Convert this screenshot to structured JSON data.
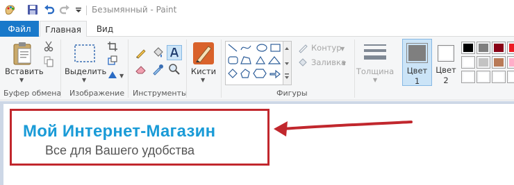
{
  "window": {
    "title": "Безымянный - Paint"
  },
  "tabs": {
    "file": "Файл",
    "home": "Главная",
    "view": "Вид"
  },
  "ribbon": {
    "clipboard": {
      "paste": "Вставить",
      "group": "Буфер обмена"
    },
    "image": {
      "select": "Выделить",
      "group": "Изображение"
    },
    "tools": {
      "group": "Инструменты"
    },
    "brushes": {
      "label": "Кисти"
    },
    "shapes": {
      "outline": "Контур",
      "fill": "Заливка",
      "group": "Фигуры"
    },
    "size": {
      "label": "Толщина"
    },
    "color1": {
      "line1": "Цвет",
      "line2": "1"
    },
    "color2": {
      "line1": "Цвет",
      "line2": "2"
    },
    "palette": [
      "#000000",
      "#7f7f7f",
      "#880015",
      "#ed1c24",
      "#ffffff",
      "#c3c3c3",
      "#b97a57",
      "#ffaec9",
      "#ffffff",
      "#ffffff",
      "#ffffff",
      "#ffffff"
    ],
    "color1_value": "#7f7f7f",
    "color2_value": "#ffffff"
  },
  "canvas": {
    "headline": "Мой Интернет-Магазин",
    "tagline": "Все для Вашего удобства",
    "frame_color": "#c1272d",
    "headline_color": "#1a9bd7",
    "arrow_color": "#c1272d"
  }
}
